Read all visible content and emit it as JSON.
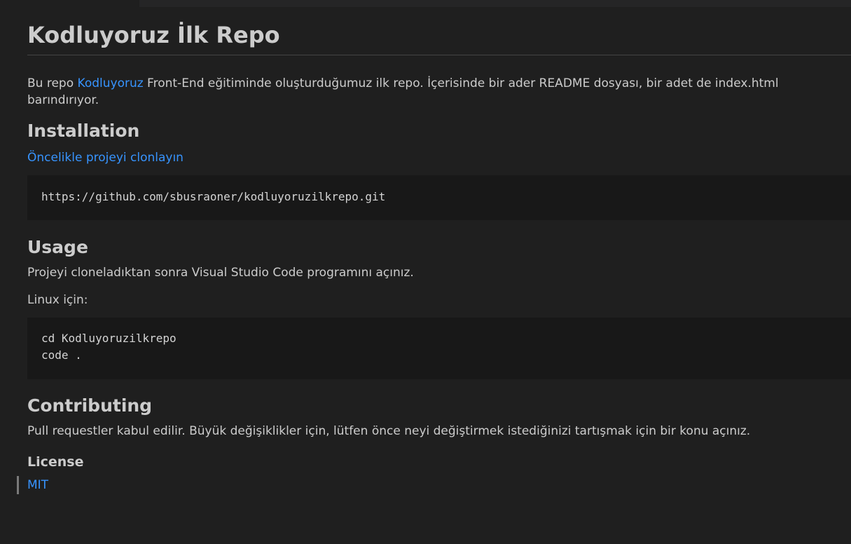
{
  "title": "Kodluyoruz İlk Repo",
  "intro": {
    "before": "Bu repo ",
    "link": "Kodluyoruz",
    "after": " Front-End eğitiminde oluşturduğumuz ilk repo. İçerisinde bir ader README dosyası, bir adet de index.html barındırıyor."
  },
  "installation": {
    "heading": "Installation",
    "link": "Öncelikle projeyi clonlayın",
    "code": "https://github.com/sbusraoner/kodluyoruzilkrepo.git"
  },
  "usage": {
    "heading": "Usage",
    "text": "Projeyi cloneladıktan sonra Visual Studio Code programını açınız.",
    "linux_label": "Linux için:",
    "code": "cd Kodluyoruzilkrepo\ncode ."
  },
  "contributing": {
    "heading": "Contributing",
    "text": "Pull requestler kabul edilir. Büyük değişiklikler için, lütfen önce neyi değiştirmek istediğinizi tartışmak için bir konu açınız."
  },
  "license": {
    "heading": "License",
    "link": "MIT"
  },
  "colors": {
    "background": "#1f1f1f",
    "text": "#cccccc",
    "link": "#3794ff",
    "code_background": "#181818"
  }
}
